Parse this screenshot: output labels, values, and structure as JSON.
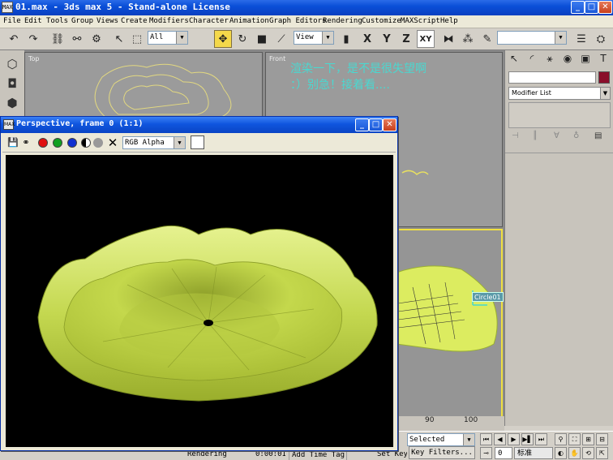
{
  "app": {
    "title": "01.max - 3ds max 5 - Stand-alone License",
    "icon_text": "MAX"
  },
  "menu": [
    "File",
    "Edit",
    "Tools",
    "Group",
    "Views",
    "Create",
    "Modifiers",
    "Character",
    "Animation",
    "Graph Editors",
    "Rendering",
    "Customize",
    "MAXScript",
    "Help"
  ],
  "toolbar": {
    "selection_filter": "All",
    "ref_coord": "View",
    "axis_x": "X",
    "axis_y": "Y",
    "axis_z": "Z",
    "axis_xy": "XY",
    "named_selection": ""
  },
  "viewports": {
    "top_label": "Top",
    "front_label": "Front",
    "annotation_line1": "渲染一下，是不是很失望啊",
    "annotation_line2": "：）别急！接着看....",
    "object_label": "Circle01"
  },
  "command_panel": {
    "object_name": "",
    "object_color": "#8a0e2a",
    "modifier_list": "Modifier List"
  },
  "timeline": {
    "tick_90": "90",
    "tick_100": "100"
  },
  "render_window": {
    "title": "Perspective, frame 0 (1:1)",
    "channel": "RGB Alpha"
  },
  "status": {
    "rendering_time_label": "Rendering Time",
    "rendering_time_value": "0:00:01",
    "add_time_tag": "Add Time Tag",
    "set_key": "Set Key",
    "selected": "Selected",
    "key_filters": "Key Filters...",
    "frame_value": "0",
    "ime_label": "标准"
  }
}
